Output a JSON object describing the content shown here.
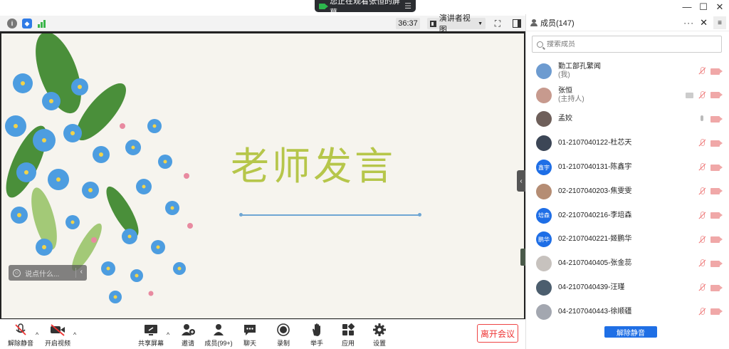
{
  "window": {
    "share_banner": "您正在观看张恒的屏幕",
    "share_menu_icon": "menu-icon",
    "minimize_icon": "—",
    "maximize_icon": "☐",
    "close_icon": "✕"
  },
  "topbar": {
    "timer": "36:37",
    "view_mode": "演讲者视图",
    "colors": {
      "info": "#777777",
      "shield": "#2f7be6",
      "signal": "#3bb54a"
    }
  },
  "slide": {
    "title": "老师发言"
  },
  "chat": {
    "placeholder": "说点什么..."
  },
  "toolbar": {
    "unmute": "解除静音",
    "start_video": "开启视频",
    "share_screen": "共享屏幕",
    "invite": "邀请",
    "members": "成员(99+)",
    "chat": "聊天",
    "record": "录制",
    "raise_hand": "举手",
    "apps": "应用",
    "settings": "设置",
    "leave": "离开会议"
  },
  "panel": {
    "title": "成员(147)",
    "search_placeholder": "搜索成员",
    "unmute_all": "解除静音",
    "participants": [
      {
        "name": "勤工部孔繁闻",
        "sub": "(我)",
        "avatar_color": "#6d9bd0",
        "initials": "",
        "mic": "off",
        "cam": "off",
        "screen": false
      },
      {
        "name": "张恒",
        "sub": "(主持人)",
        "avatar_color": "#c79a8e",
        "initials": "",
        "mic": "off",
        "cam": "off",
        "screen": true
      },
      {
        "name": "孟姣",
        "sub": "",
        "avatar_color": "#6e5f5a",
        "initials": "",
        "mic": "on",
        "cam": "off",
        "screen": false
      },
      {
        "name": "01-2107040122-杜芯天",
        "sub": "",
        "avatar_color": "#3c4656",
        "initials": "",
        "mic": "off",
        "cam": "off",
        "screen": false
      },
      {
        "name": "01-2107040131-陈鑫宇",
        "sub": "",
        "avatar_color": "#1e6ee6",
        "initials": "鑫宇",
        "mic": "off",
        "cam": "off",
        "screen": false
      },
      {
        "name": "02-2107040203-焦雯雯",
        "sub": "",
        "avatar_color": "#b58d74",
        "initials": "",
        "mic": "off",
        "cam": "off",
        "screen": false
      },
      {
        "name": "02-2107040216-李培森",
        "sub": "",
        "avatar_color": "#1e6ee6",
        "initials": "培森",
        "mic": "off",
        "cam": "off",
        "screen": false
      },
      {
        "name": "02-2107040221-姬鹏华",
        "sub": "",
        "avatar_color": "#1e6ee6",
        "initials": "鹏华",
        "mic": "off",
        "cam": "off",
        "screen": false
      },
      {
        "name": "04-2107040405-张金蕊",
        "sub": "",
        "avatar_color": "#c7c2be",
        "initials": "",
        "mic": "off",
        "cam": "off",
        "screen": false
      },
      {
        "name": "04-2107040439-汪瑾",
        "sub": "",
        "avatar_color": "#4c5e6e",
        "initials": "",
        "mic": "off",
        "cam": "off",
        "screen": false
      },
      {
        "name": "04-2107040443-徐顺疆",
        "sub": "",
        "avatar_color": "#a3a7b0",
        "initials": "",
        "mic": "off",
        "cam": "off",
        "screen": false
      }
    ]
  }
}
